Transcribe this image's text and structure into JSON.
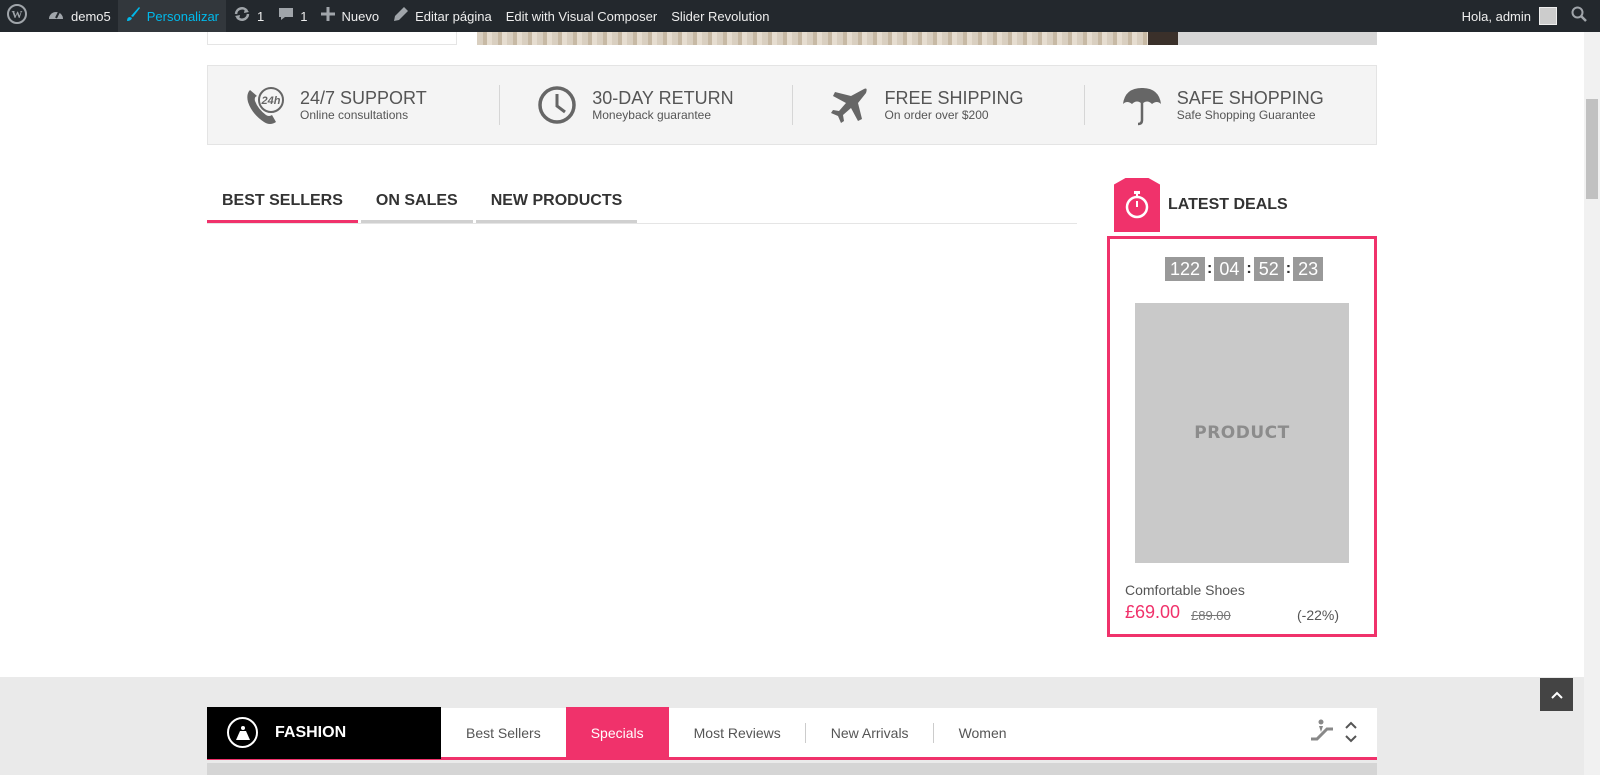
{
  "adminbar": {
    "items": [
      {
        "icon": "wordpress-icon",
        "label": ""
      },
      {
        "icon": "dashboard-icon",
        "label": "demo5"
      },
      {
        "icon": "brush-icon",
        "label": "Personalizar"
      },
      {
        "icon": "updates-icon",
        "label": "1"
      },
      {
        "icon": "comment-icon",
        "label": "1"
      },
      {
        "icon": "plus-icon",
        "label": "Nuevo"
      },
      {
        "icon": "pencil-icon",
        "label": "Editar página"
      },
      {
        "icon": "",
        "label": "Edit with Visual Composer"
      },
      {
        "icon": "",
        "label": "Slider Revolution"
      }
    ],
    "greeting": "Hola, admin"
  },
  "services": [
    {
      "icon": "24h-phone-icon",
      "title": "24/7 SUPPORT",
      "subtitle": "Online consultations"
    },
    {
      "icon": "clock-icon",
      "title": "30-DAY RETURN",
      "subtitle": "Moneyback guarantee"
    },
    {
      "icon": "airplane-icon",
      "title": "FREE SHIPPING",
      "subtitle": "On order over $200"
    },
    {
      "icon": "umbrella-icon",
      "title": "SAFE SHOPPING",
      "subtitle": "Safe Shopping Guarantee"
    }
  ],
  "product_tabs": [
    {
      "label": "BEST SELLERS",
      "active": true
    },
    {
      "label": "ON SALES",
      "active": false
    },
    {
      "label": "NEW PRODUCTS",
      "active": false
    }
  ],
  "latest_deals": {
    "title": "LATEST DEALS",
    "icon": "stopwatch-icon",
    "countdown": [
      "122",
      "04",
      "52",
      "23"
    ],
    "product": {
      "image_label": "PRODUCT",
      "name": "Comfortable Shoes",
      "price": "£69.00",
      "old_price": "£89.00",
      "discount": "(-22%)"
    }
  },
  "fashion": {
    "title": "FASHION",
    "icon": "dress-icon",
    "tabs": [
      {
        "label": "Best Sellers",
        "active": false
      },
      {
        "label": "Specials",
        "active": true
      },
      {
        "label": "Most Reviews",
        "active": false
      },
      {
        "label": "New Arrivals",
        "active": false
      },
      {
        "label": "Women",
        "active": false
      }
    ]
  },
  "colors": {
    "accent": "#f0326b",
    "adminbar": "#23282d",
    "adminbar_active": "#00b9eb"
  }
}
